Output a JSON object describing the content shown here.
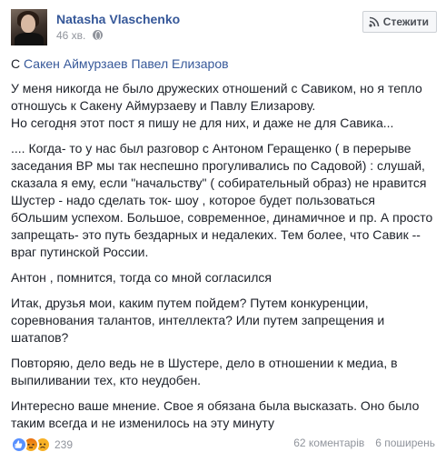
{
  "post": {
    "author": "Natasha Vlaschenko",
    "time": "46 хв.",
    "follow_label": "Стежити",
    "with_prefix": "С",
    "tagged": [
      "Сакен Аймурзаев",
      "Павел Елизаров"
    ],
    "paragraphs": [
      "У меня никогда не было дружеских отношений с Савиком, но я тепло отношусь к Сакену Аймурзаеву и Павлу Елизарову.\nНо сегодня этот пост я пишу не для них, и даже не для Савика...",
      ".... Когда- то у нас был разговор с Антоном Геращенко ( в перерыве заседания ВР мы так неспешно прогуливались по Садовой) : слушай, сказала я ему, если \"начальству\" ( собирательный образ) не нравится Шустер - надо сделать ток- шоу , которое будет пользоваться бОльшим успехом. Большое, современное, динамичное и пр. А просто запрещать- это путь бездарных и недалеких. Тем более, что Савик -- враг путинской России.",
      "Антон , помнится, тогда со мной согласился",
      "Итак, друзья мои, каким путем пойдем? Путем конкуренции, соревнования талантов, интеллекта? Или путем запрещения и шатапов?",
      "Повторяю, дело ведь не в Шустере, дело в отношении к медиа, в выпиливании тех, кто неудобен.",
      "Интересно ваше мнение. Свое я обязана была высказать. Оно было таким всегда и не изменилось на эту минуту"
    ],
    "reactions_count": "239",
    "comments": "62 коментарів",
    "shares": "6 поширень"
  },
  "icons": {
    "privacy": "globe-icon",
    "follow": "rss-icon",
    "reactions": [
      "like-icon",
      "angry-icon",
      "sad-icon"
    ]
  },
  "colors": {
    "link": "#365899",
    "meta": "#90949c",
    "text": "#1d2129"
  }
}
